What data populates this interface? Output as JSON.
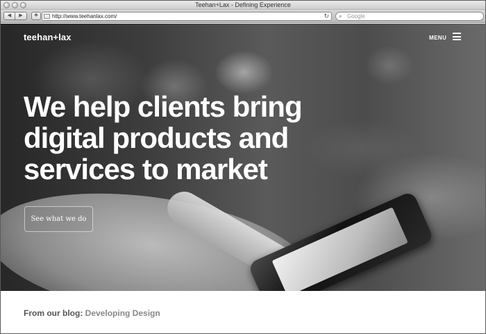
{
  "window": {
    "title": "Teehan+Lax - Defining Experience"
  },
  "toolbar": {
    "back_icon": "back-icon",
    "forward_icon": "forward-icon",
    "back_glyph": "◀",
    "forward_glyph": "▶",
    "add_glyph": "+",
    "url": "http://www.teehanlax.com/",
    "reload_glyph": "↻",
    "search_placeholder": "Google",
    "search_glyph": "⌕"
  },
  "site": {
    "logo": "teehan+lax",
    "menu_label": "MENU",
    "headline": "We help clients bring digital products and services to market",
    "cta_label": "See what we do",
    "blog_prefix": "From our blog:",
    "blog_link": "Developing Design"
  }
}
